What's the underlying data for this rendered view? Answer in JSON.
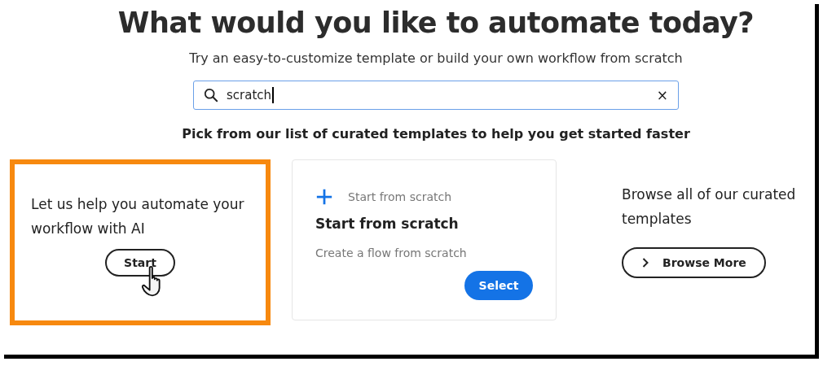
{
  "heading": "What would you like to automate today?",
  "subheading": "Try an easy-to-customize template or build your own workflow from scratch",
  "search": {
    "value": "scratch",
    "clear": "×"
  },
  "prompt": "Pick from our list of curated templates to help you get started faster",
  "ai_card": {
    "text": "Let us help you automate your workflow with AI",
    "button": "Start",
    "highlighted": true
  },
  "template_card": {
    "tag": "Start from scratch",
    "title": "Start from scratch",
    "description": "Create a flow from scratch",
    "button": "Select"
  },
  "browse": {
    "text": "Browse all of our curated templates",
    "button": "Browse More"
  }
}
